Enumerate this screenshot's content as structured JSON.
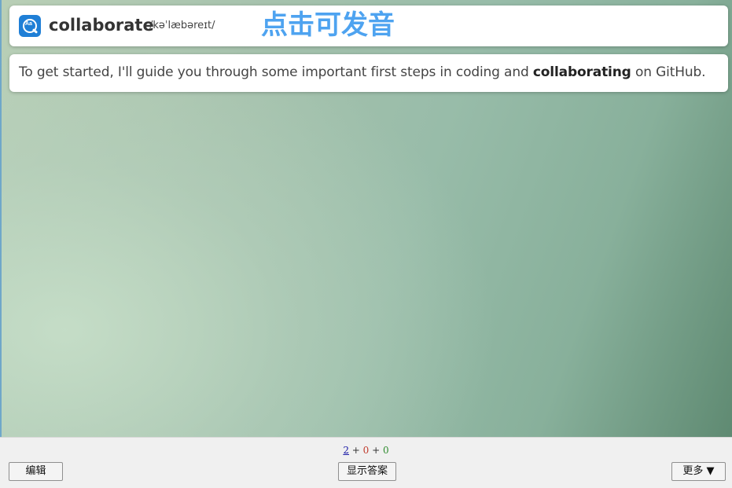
{
  "word": "collaborate",
  "phonetic": "/kəˈlæbəreɪt/",
  "pronounce_label": "点击可发音",
  "sentence": {
    "before": "To get started, I'll guide you through some important first steps in coding and ",
    "highlight": "collaborating",
    "after": " on GitHub."
  },
  "counts": {
    "new": "2",
    "sep1": " + ",
    "learn": "0",
    "sep2": " + ",
    "due": "0"
  },
  "buttons": {
    "edit": "编辑",
    "show_answer": "显示答案",
    "more": "更多 ▼"
  },
  "colors": {
    "pronounce": "#4ea3f0",
    "icon": "#1f7fd6",
    "new": "#1a1aa6",
    "learn": "#c0392b",
    "due": "#2e8b2e"
  },
  "icons": {
    "app": "dictionary-app-icon"
  }
}
